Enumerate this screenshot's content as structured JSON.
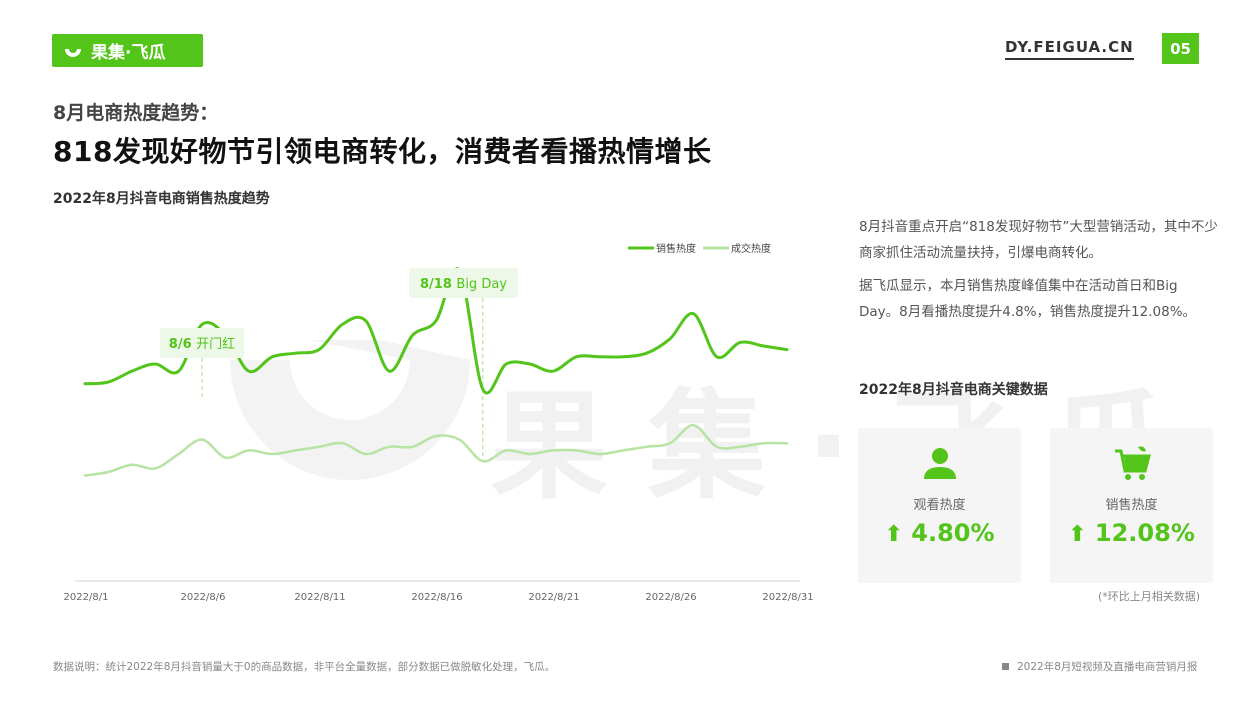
{
  "header": {
    "logo_text": "果集·飞瓜",
    "site": "DY.FEIGUA.CN",
    "page_number": "05",
    "accent_color": "#52c41a"
  },
  "subtitle": "8月电商热度趋势：",
  "title": "818发现好物节引领电商转化，消费者看播热情增长",
  "chart_title": "2022年8月抖音电商销售热度趋势",
  "chart_data": {
    "type": "line",
    "x": [
      "2022/8/1",
      "2022/8/2",
      "2022/8/3",
      "2022/8/4",
      "2022/8/5",
      "2022/8/6",
      "2022/8/7",
      "2022/8/8",
      "2022/8/9",
      "2022/8/10",
      "2022/8/11",
      "2022/8/12",
      "2022/8/13",
      "2022/8/14",
      "2022/8/15",
      "2022/8/16",
      "2022/8/17",
      "2022/8/18",
      "2022/8/19",
      "2022/8/20",
      "2022/8/21",
      "2022/8/22",
      "2022/8/23",
      "2022/8/24",
      "2022/8/25",
      "2022/8/26",
      "2022/8/27",
      "2022/8/28",
      "2022/8/29",
      "2022/8/30",
      "2022/8/31"
    ],
    "x_ticks": [
      "2022/8/1",
      "2022/8/6",
      "2022/8/11",
      "2022/8/16",
      "2022/8/21",
      "2022/8/26",
      "2022/8/31"
    ],
    "ylim": [
      0,
      100
    ],
    "grid": false,
    "legend_position": "top-right",
    "series": [
      {
        "name": "销售热度",
        "color": "#52c41a",
        "values": [
          54.5,
          55,
          58,
          60,
          58,
          71,
          68,
          58,
          62,
          63,
          64,
          71,
          72,
          58,
          68,
          72,
          86,
          53,
          60,
          60,
          58,
          62,
          62,
          62,
          63,
          67,
          74,
          62,
          66,
          65,
          64
        ]
      },
      {
        "name": "成交热度",
        "color": "#b7e4a3",
        "values": [
          29,
          30,
          32,
          31,
          35,
          39,
          34,
          36,
          35,
          36,
          37,
          38,
          35,
          37,
          37,
          40,
          39,
          33,
          36,
          35,
          36,
          36,
          35,
          36,
          37,
          38,
          43,
          37,
          37,
          38,
          38
        ]
      }
    ],
    "annotations": [
      {
        "x": "2022/8/6",
        "bold": "8/6",
        "text": "开门红"
      },
      {
        "x": "2022/8/18",
        "bold": "8/18",
        "text": "Big Day"
      }
    ]
  },
  "description": {
    "p1": "8月抖音重点开启“818发现好物节”大型营销活动，其中不少商家抓住活动流量扶持，引爆电商转化。",
    "p2": "据飞瓜显示，本月销售热度峰值集中在活动首日和Big Day。8月看播热度提升4.8%，销售热度提升12.08%。"
  },
  "key_data": {
    "title": "2022年8月抖音电商关键数据",
    "cards": [
      {
        "icon": "person-icon",
        "label": "观看热度",
        "value": "4.80%",
        "trend": "up"
      },
      {
        "icon": "cart-icon",
        "label": "销售热度",
        "value": "12.08%",
        "trend": "up"
      }
    ],
    "note": "(*环比上月相关数据)"
  },
  "watermark_text": "果集·飞瓜",
  "footer": {
    "left": "数据说明：统计2022年8月抖音销量大于0的商品数据，非平台全量数据，部分数据已做脱敏化处理，飞瓜。",
    "right": "2022年8月短视频及直播电商营销月报"
  }
}
